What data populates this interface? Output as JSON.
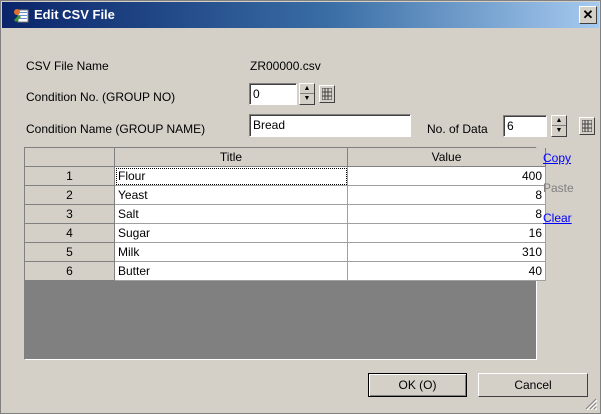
{
  "window": {
    "title": "Edit CSV File",
    "close_glyph": "✕"
  },
  "form": {
    "csv_file_label": "CSV File Name",
    "csv_file_value": "ZR00000.csv",
    "condition_no_label": "Condition No. (GROUP NO)",
    "condition_no_value": "0",
    "condition_name_label": "Condition Name (GROUP NAME)",
    "condition_name_value": "Bread",
    "no_of_data_label": "No. of Data",
    "no_of_data_value": "6"
  },
  "table": {
    "columns": [
      "",
      "Title",
      "Value"
    ],
    "rows": [
      {
        "index": "1",
        "title": "Flour",
        "value": "400"
      },
      {
        "index": "2",
        "title": "Yeast",
        "value": "8"
      },
      {
        "index": "3",
        "title": "Salt",
        "value": "8"
      },
      {
        "index": "4",
        "title": "Sugar",
        "value": "16"
      },
      {
        "index": "5",
        "title": "Milk",
        "value": "310"
      },
      {
        "index": "6",
        "title": "Butter",
        "value": "40"
      }
    ]
  },
  "side_actions": {
    "copy": "Copy",
    "paste": "Paste",
    "clear": "Clear"
  },
  "buttons": {
    "ok": "OK (O)",
    "cancel": "Cancel"
  },
  "icons": [
    "csv-edit-icon",
    "close-icon",
    "spin-up-icon",
    "spin-down-icon",
    "grid-icon",
    "resize-grip-icon"
  ]
}
